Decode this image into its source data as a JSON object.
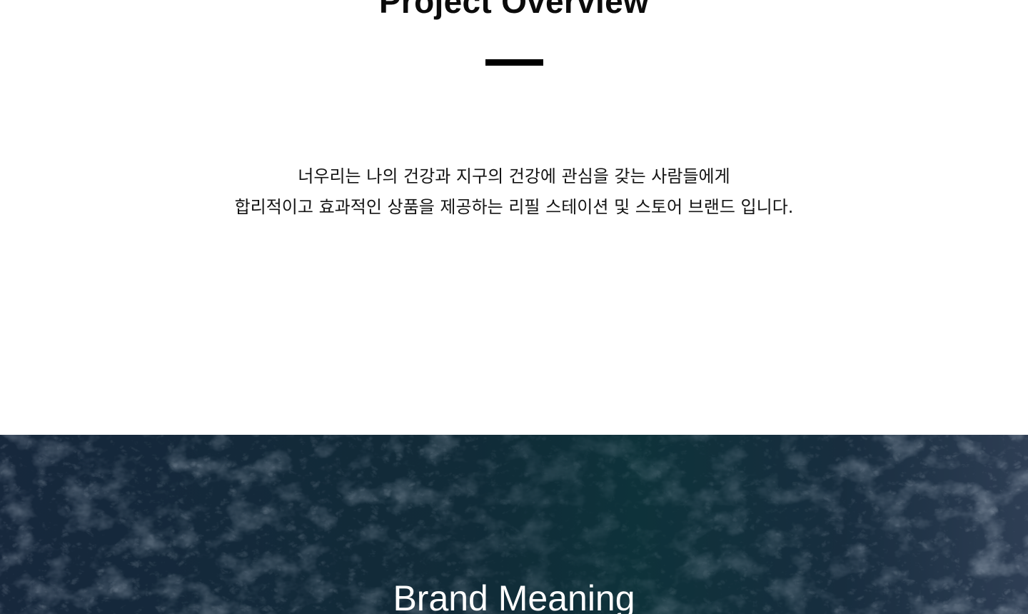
{
  "overview": {
    "title": "Project Overview",
    "lines": [
      "너우리는 나의 건강과 지구의 건강에 관심을 갖는 사람들에게",
      "합리적이고 효과적인 상품을 제공하는 리필 스테이션 및 스토어 브랜드 입니다."
    ]
  },
  "brand": {
    "title": "Brand Meaning",
    "background_image": "ocean-waves-aerial"
  },
  "colors": {
    "page_background": "#ffffff",
    "text": "#0b0b0b",
    "accent_rule": "#000000",
    "ocean_dark": "#17283a",
    "ocean_teal": "#123c44",
    "foam": "#a9b8cc"
  }
}
